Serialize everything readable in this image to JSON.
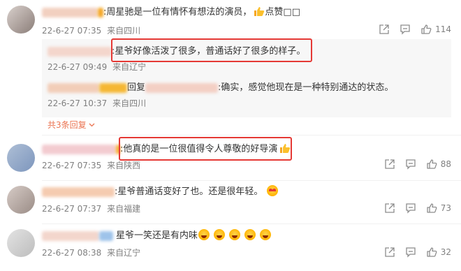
{
  "comments": [
    {
      "text": ":周星驰是一位有情怀有想法的演员，",
      "text_suffix": "点赞",
      "text_tail": "□□",
      "date": "22-6-27 07:35",
      "location": "来自四川",
      "likes": "114",
      "replies": [
        {
          "text": ":星爷好像活泼了很多，普通话好了很多的样子。",
          "date": "22-6-27 09:49",
          "location": "来自辽宁"
        },
        {
          "text_prefix": "回复",
          "text": ":确实，感觉他现在是一种特别通达的状态。",
          "date": "22-6-27 10:37",
          "location": "来自四川"
        }
      ],
      "more_replies": "共3条回复"
    },
    {
      "text": ":他真的是一位很值得令人尊敬的好导演",
      "date": "22-6-27 07:35",
      "location": "来自陕西",
      "likes": "88"
    },
    {
      "text": ":星爷普通话变好了也。还是很年轻。",
      "date": "22-6-27 07:37",
      "location": "来自福建",
      "likes": "73"
    },
    {
      "text": "星爷一笑还是有内味",
      "date": "22-6-27 08:38",
      "location": "来自辽宁",
      "likes": "32"
    }
  ],
  "colors": {
    "highlight_box": "#e53935",
    "more_link": "#eb7350",
    "meta_text": "#808080"
  },
  "icons": [
    "share-icon",
    "comment-icon",
    "like-icon",
    "thumbs-up-emoji",
    "heart-eyes-emoji",
    "crying-laughing-emoji",
    "chevron-down-icon"
  ]
}
